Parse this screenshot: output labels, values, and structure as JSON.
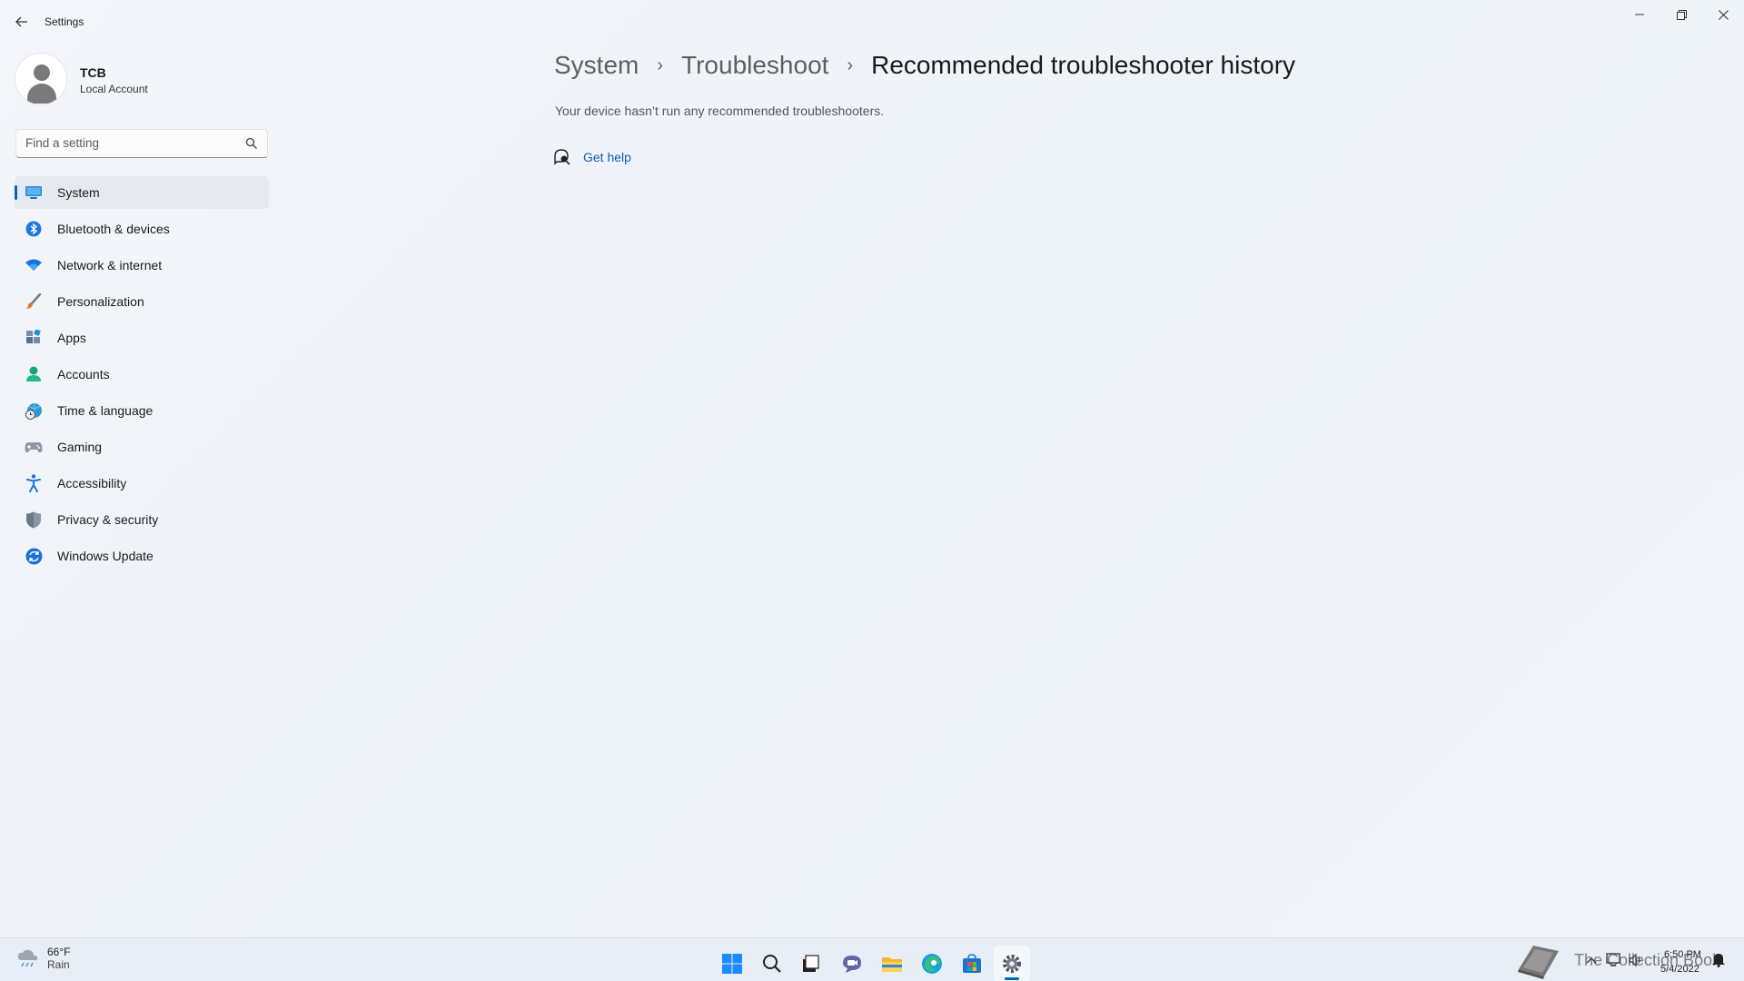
{
  "window": {
    "title": "Settings",
    "controls": {
      "minimize_icon": "minimize-icon",
      "maximize_icon": "restore-icon",
      "close_icon": "close-icon"
    }
  },
  "profile": {
    "name": "TCB",
    "account_type": "Local Account"
  },
  "search": {
    "placeholder": "Find a setting"
  },
  "sidebar": {
    "items": [
      {
        "label": "System",
        "icon": "monitor-icon",
        "active": true
      },
      {
        "label": "Bluetooth & devices",
        "icon": "bluetooth-icon",
        "active": false
      },
      {
        "label": "Network & internet",
        "icon": "wifi-icon",
        "active": false
      },
      {
        "label": "Personalization",
        "icon": "brush-icon",
        "active": false
      },
      {
        "label": "Apps",
        "icon": "apps-icon",
        "active": false
      },
      {
        "label": "Accounts",
        "icon": "person-icon",
        "active": false
      },
      {
        "label": "Time & language",
        "icon": "globe-clock-icon",
        "active": false
      },
      {
        "label": "Gaming",
        "icon": "gamepad-icon",
        "active": false
      },
      {
        "label": "Accessibility",
        "icon": "accessibility-icon",
        "active": false
      },
      {
        "label": "Privacy & security",
        "icon": "shield-icon",
        "active": false
      },
      {
        "label": "Windows Update",
        "icon": "update-icon",
        "active": false
      }
    ]
  },
  "breadcrumb": {
    "items": [
      "System",
      "Troubleshoot",
      "Recommended troubleshooter history"
    ]
  },
  "main": {
    "empty_message": "Your device hasn’t run any recommended troubleshooters.",
    "help_link": "Get help"
  },
  "taskbar": {
    "weather": {
      "temp": "66°F",
      "condition": "Rain"
    },
    "clock": {
      "time": "6:50 PM",
      "date": "5/4/2022"
    },
    "watermark": "The Collection Book"
  },
  "colors": {
    "accent": "#0067c0",
    "link": "#0a5dad",
    "background": "#eef3f9"
  }
}
